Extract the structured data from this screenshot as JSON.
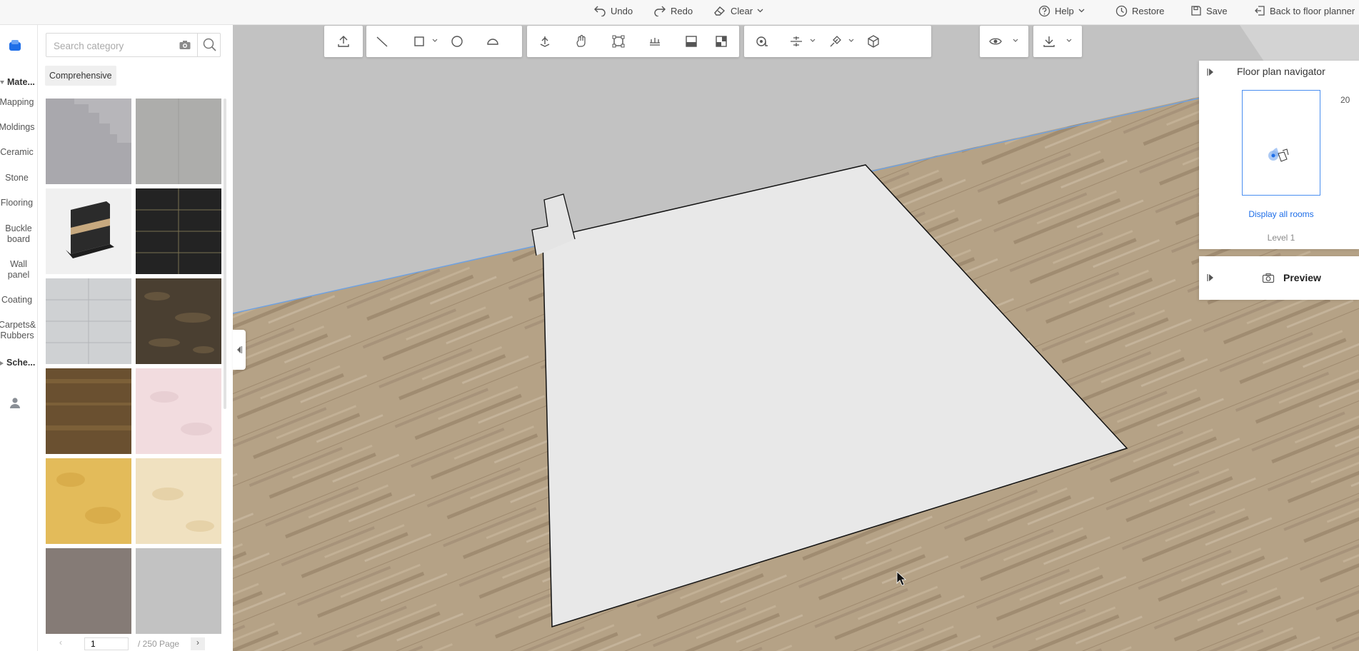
{
  "topbar": {
    "undo": "Undo",
    "redo": "Redo",
    "clear": "Clear",
    "help": "Help",
    "restore": "Restore",
    "save": "Save",
    "back": "Back to floor planner"
  },
  "rail": {
    "materials_head": "Mate...",
    "items": [
      "Mapping",
      "Moldings",
      "Ceramic",
      "Stone",
      "Flooring",
      "Buckle board",
      "Wall panel",
      "Coating",
      "Carpets& Rubbers"
    ],
    "schemes_head": "Sche..."
  },
  "panel": {
    "search_placeholder": "Search category",
    "filter": "Comprehensive",
    "tiles": [
      {
        "name": "grey-wall-tile",
        "color": "#a9a8ad"
      },
      {
        "name": "light-grey-panel-tile",
        "color": "#adadab"
      },
      {
        "name": "skirting-molding-tile",
        "color": "#f0f0f0"
      },
      {
        "name": "black-tile-grid",
        "color": "#232323"
      },
      {
        "name": "white-tile-grid",
        "color": "#cfd1d3"
      },
      {
        "name": "dark-stone-tile",
        "color": "#4a3f31"
      },
      {
        "name": "brown-wood-tile",
        "color": "#6a5030"
      },
      {
        "name": "pink-marble-tile",
        "color": "#f2dcdf"
      },
      {
        "name": "yellow-stone-tile",
        "color": "#e3bb5a"
      },
      {
        "name": "cream-marble-tile",
        "color": "#f0e1c0"
      },
      {
        "name": "taupe-tile",
        "color": "#857b76"
      },
      {
        "name": "silver-tile",
        "color": "#c2c2c2"
      }
    ],
    "page_current": "1",
    "page_total": "/ 250 Page"
  },
  "navigator": {
    "title": "Floor plan navigator",
    "scale": "20",
    "display_all": "Display all rooms",
    "level": "Level 1"
  },
  "preview": {
    "label": "Preview"
  },
  "colors": {
    "accent": "#1e6ee8",
    "floor_wood": "#b5a286",
    "wall": "#c2c2c2",
    "floor_white": "#e8e8e8"
  }
}
